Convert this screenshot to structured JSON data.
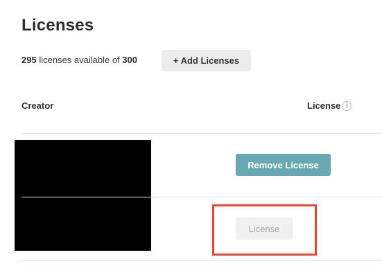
{
  "page": {
    "title": "Licenses"
  },
  "availability": {
    "available_count": "295",
    "middle_text": " licenses available of ",
    "total_count": "300"
  },
  "actions": {
    "add_label": "+ Add Licenses"
  },
  "table": {
    "columns": [
      "Creator",
      "License"
    ],
    "rows": [
      {
        "action_label": "Remove License",
        "action_state": "enabled"
      },
      {
        "action_label": "License",
        "action_state": "disabled"
      }
    ]
  },
  "icons": {
    "info": "info-icon"
  },
  "colors": {
    "remove_button": "#66a9b2",
    "highlight": "#e8462e",
    "add_button_bg": "#ececec",
    "disabled_button_bg": "#f0f0f0"
  }
}
